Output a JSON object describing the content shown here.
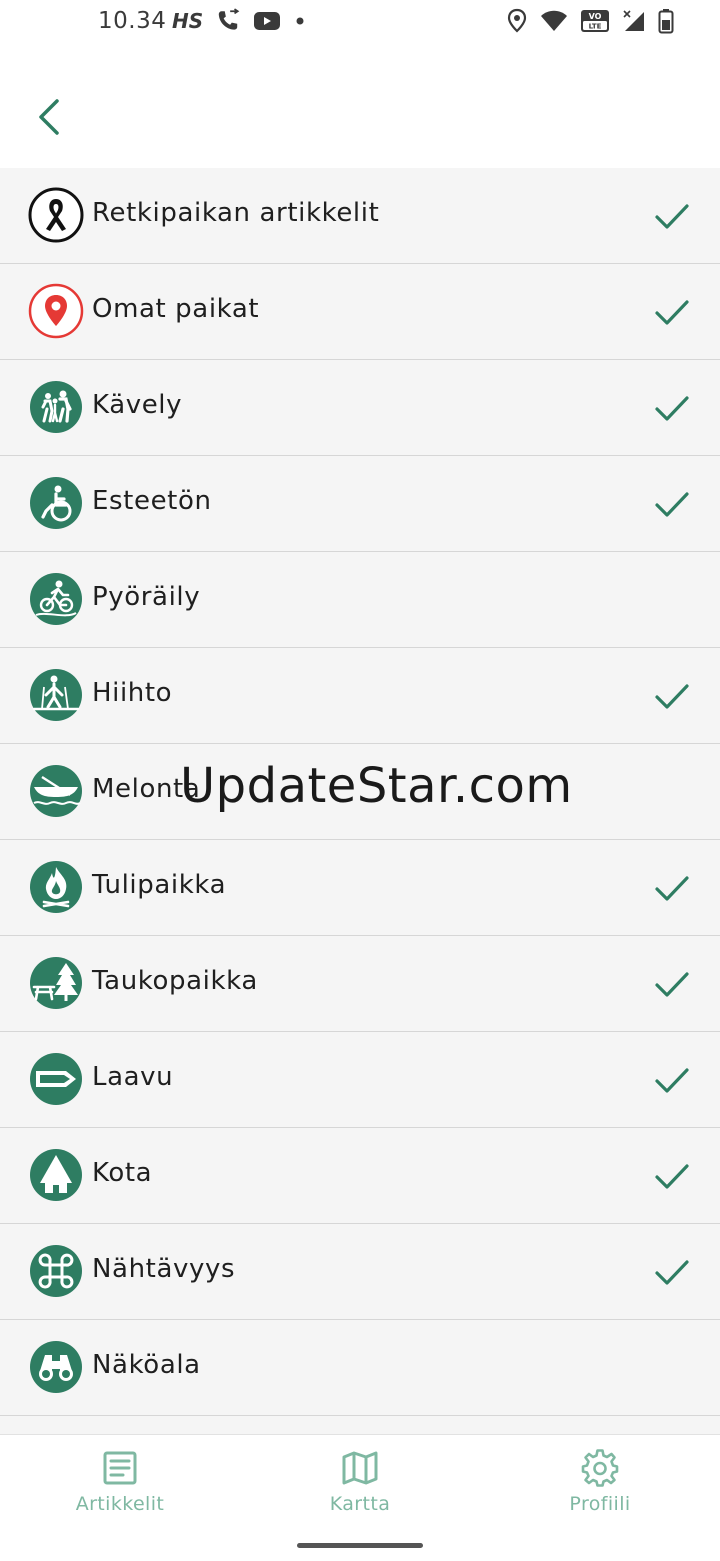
{
  "status_bar": {
    "time": "10.34",
    "network_badge": "HS",
    "icons": [
      "wifi-call-icon",
      "youtube-icon",
      "notification-dot-icon",
      "location-icon",
      "wifi-icon",
      "volte-icon",
      "signal-icon",
      "battery-icon"
    ],
    "volte_top": "VO",
    "volte_bottom": "LTE"
  },
  "app_bar": {
    "back_icon": "chevron-left-icon"
  },
  "list": {
    "items": [
      {
        "label": "Retkipaikan artikkelit",
        "icon": "retkipaikka-logo-icon",
        "checked": true
      },
      {
        "label": "Omat paikat",
        "icon": "map-pin-icon",
        "checked": true
      },
      {
        "label": "Kävely",
        "icon": "walking-icon",
        "checked": true
      },
      {
        "label": "Esteetön",
        "icon": "wheelchair-icon",
        "checked": true
      },
      {
        "label": "Pyöräily",
        "icon": "cycling-icon",
        "checked": false
      },
      {
        "label": "Hiihto",
        "icon": "skiing-icon",
        "checked": true
      },
      {
        "label": "Melonta",
        "icon": "canoe-icon",
        "checked": false
      },
      {
        "label": "Tulipaikka",
        "icon": "campfire-icon",
        "checked": true
      },
      {
        "label": "Taukopaikka",
        "icon": "picnic-table-icon",
        "checked": true
      },
      {
        "label": "Laavu",
        "icon": "lean-to-shelter-icon",
        "checked": true
      },
      {
        "label": "Kota",
        "icon": "hut-icon",
        "checked": true
      },
      {
        "label": "Nähtävyys",
        "icon": "sight-icon",
        "checked": true
      },
      {
        "label": "Näköala",
        "icon": "binoculars-icon",
        "checked": false
      }
    ]
  },
  "watermark": "UpdateStar.com",
  "bottom_nav": {
    "items": [
      {
        "label": "Artikkelit",
        "icon": "article-icon"
      },
      {
        "label": "Kartta",
        "icon": "map-icon"
      },
      {
        "label": "Profiili",
        "icon": "gear-icon"
      }
    ]
  },
  "colors": {
    "accent": "#2e7d62",
    "nav_inactive": "#7fb8a2",
    "pin_red": "#e53935",
    "list_bg": "#f5f5f5",
    "divider": "#d6d6d6"
  }
}
